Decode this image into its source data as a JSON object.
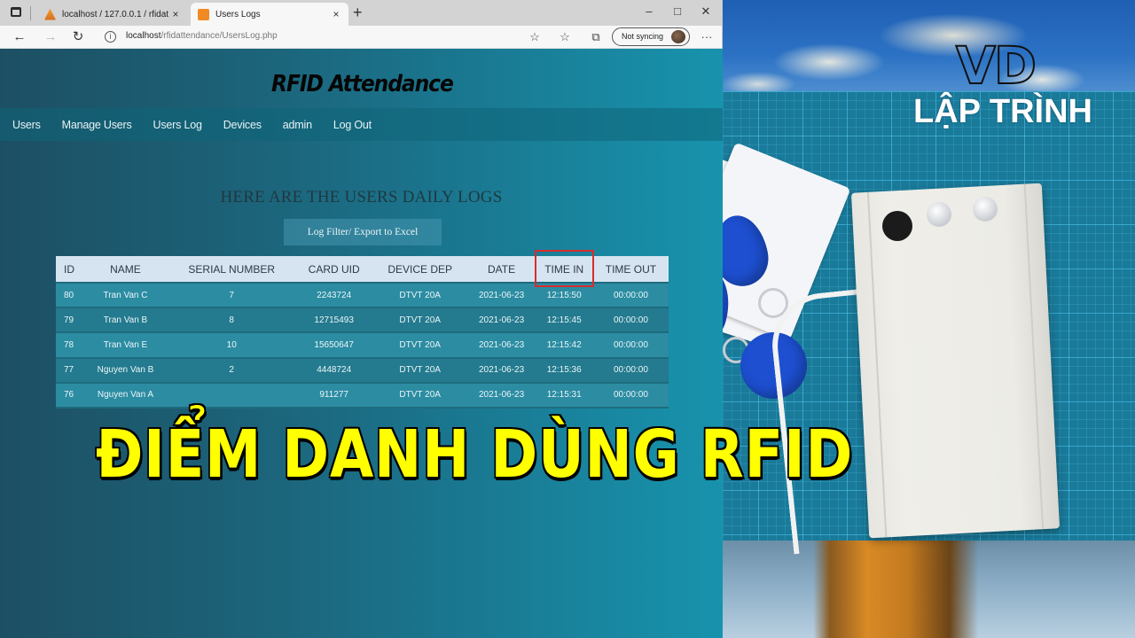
{
  "browser": {
    "tabs": [
      {
        "title": "localhost / 127.0.0.1 / rfidattend",
        "favicon": "phpmyadmin-icon",
        "active": false
      },
      {
        "title": "Users Logs",
        "favicon": "users-logs-icon",
        "active": true
      }
    ],
    "url_host": "localhost",
    "url_path": "/rfidattendance/UsersLog.php",
    "sync_label": "Not syncing",
    "icons": {
      "back": "←",
      "forward": "→",
      "reload": "↻",
      "info": "i",
      "new_tab": "+",
      "close_tab": "×",
      "minimize": "–",
      "maximize": "□",
      "close": "✕",
      "favorite_add": "☆",
      "favorites": "☆",
      "collections": "⧉",
      "more": "···"
    }
  },
  "page": {
    "title": "RFID Attendance",
    "nav": [
      "Users",
      "Manage Users",
      "Users Log",
      "Devices",
      "admin",
      "Log Out"
    ],
    "heading": "HERE ARE THE USERS DAILY LOGS",
    "filter_button": "Log Filter/ Export to Excel",
    "table": {
      "columns": [
        "ID",
        "NAME",
        "SERIAL NUMBER",
        "CARD UID",
        "DEVICE DEP",
        "DATE",
        "TIME IN",
        "TIME OUT"
      ],
      "highlighted_column": "TIME IN",
      "rows": [
        [
          "80",
          "Tran Van C",
          "7",
          "2243724",
          "DTVT 20A",
          "2021-06-23",
          "12:15:50",
          "00:00:00"
        ],
        [
          "79",
          "Tran Van B",
          "8",
          "12715493",
          "DTVT 20A",
          "2021-06-23",
          "12:15:45",
          "00:00:00"
        ],
        [
          "78",
          "Tran Van E",
          "10",
          "15650647",
          "DTVT 20A",
          "2021-06-23",
          "12:15:42",
          "00:00:00"
        ],
        [
          "77",
          "Nguyen Van B",
          "2",
          "4448724",
          "DTVT 20A",
          "2021-06-23",
          "12:15:36",
          "00:00:00"
        ],
        [
          "76",
          "Nguyen Van A",
          "",
          "911277",
          "DTVT 20A",
          "2021-06-23",
          "12:15:31",
          "00:00:00"
        ]
      ]
    }
  },
  "overlay": {
    "logo_mark": "VD",
    "logo_text": "LẬP TRÌNH",
    "caption": "ĐIỂM DANH DÙNG RFID",
    "caption_color": "#ffff00",
    "highlight_color": "#d62d2d"
  }
}
